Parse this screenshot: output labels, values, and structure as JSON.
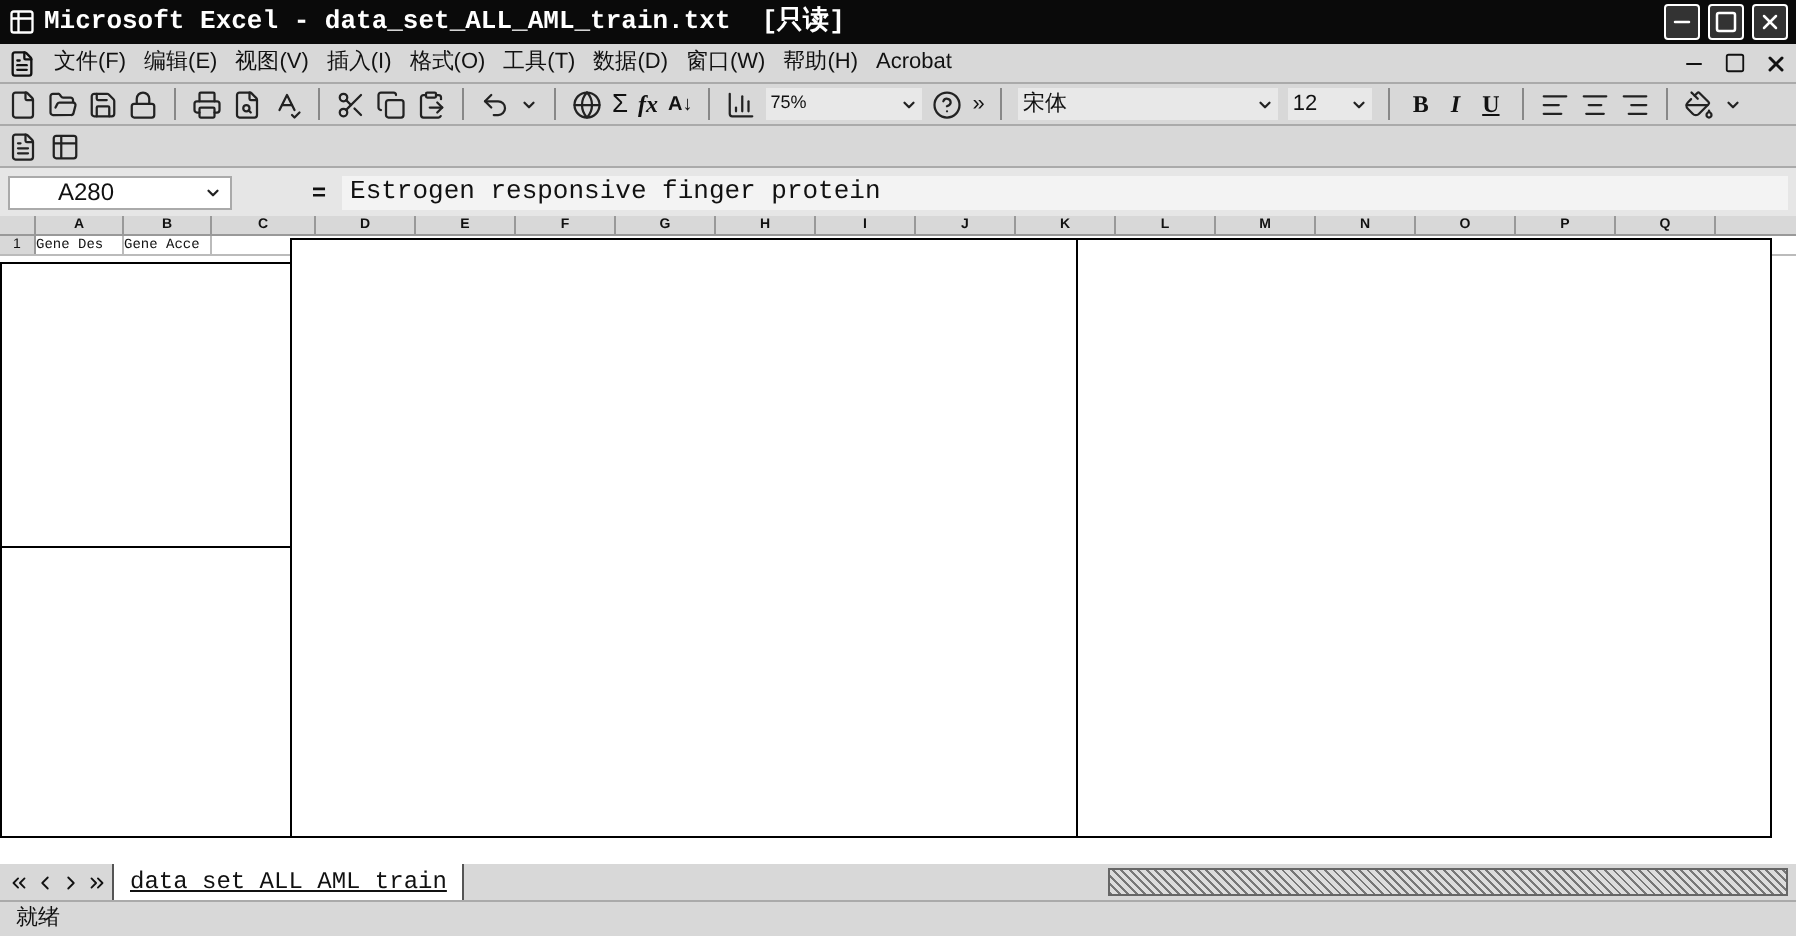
{
  "window": {
    "title": "Microsoft Excel - data_set_ALL_AML_train.txt  [只读]"
  },
  "menu": [
    "文件(F)",
    "编辑(E)",
    "视图(V)",
    "插入(I)",
    "格式(O)",
    "工具(T)",
    "数据(D)",
    "窗口(W)",
    "帮助(H)",
    "Acrobat"
  ],
  "toolbar": {
    "sigma": "Σ",
    "fx": "fx",
    "sort": "A↓",
    "zoom": "75%",
    "more": "»",
    "font": "宋体",
    "size": "12",
    "format": [
      "B",
      "I",
      "U"
    ]
  },
  "formula_bar": {
    "name_box": "A280",
    "equals": "=",
    "value": "Estrogen responsive finger protein"
  },
  "columns": [
    "A",
    "B",
    "C",
    "D",
    "E",
    "F",
    "G",
    "H",
    "I",
    "J",
    "K",
    "L",
    "M",
    "N",
    "O",
    "P",
    "Q"
  ],
  "rows": [
    {
      "header": "1",
      "cells": [
        "Gene Des",
        "Gene Acce"
      ]
    }
  ],
  "sheet_tabs": [
    {
      "label": "data set ALL AML train",
      "selected": true
    }
  ],
  "status_bar": {
    "text": "就绪"
  }
}
